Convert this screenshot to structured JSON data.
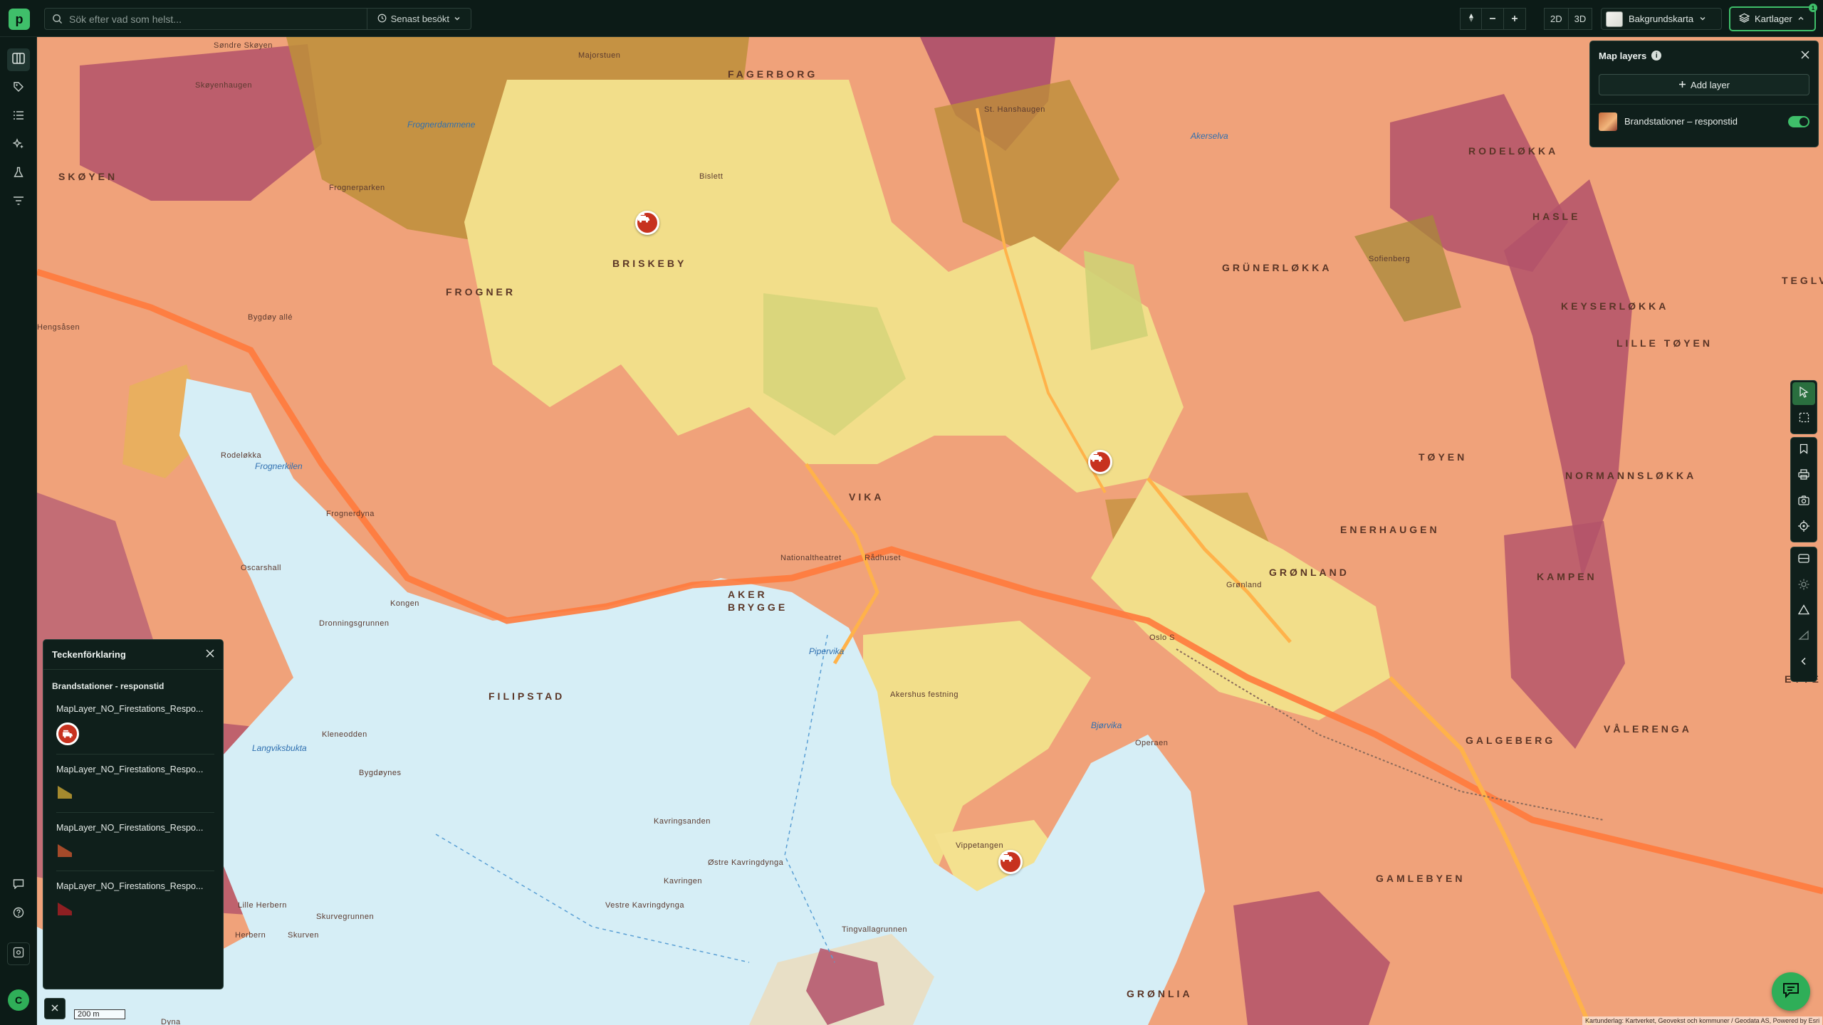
{
  "topbar": {
    "search_placeholder": "Sök efter vad som helst...",
    "recent_label": "Senast besökt",
    "view_2d": "2D",
    "view_3d": "3D",
    "basemap_label": "Bakgrundskarta",
    "layers_label": "Kartlager",
    "layers_badge": "1"
  },
  "user": {
    "initial": "C"
  },
  "layers_panel": {
    "title": "Map layers",
    "add_layer_label": "Add layer",
    "layers": [
      {
        "name": "Brandstationer – responstid",
        "visible": true
      }
    ]
  },
  "legend": {
    "title": "Teckenförklaring",
    "group_title": "Brandstationer - responstid",
    "items": [
      {
        "label": "MapLayer_NO_Firestations_Respo...",
        "symbol": "firetruck-marker",
        "color": "#c7321f"
      },
      {
        "label": "MapLayer_NO_Firestations_Respo...",
        "symbol": "polygon",
        "color": "#a58a2e"
      },
      {
        "label": "MapLayer_NO_Firestations_Respo...",
        "symbol": "polygon",
        "color": "#a54a2a"
      },
      {
        "label": "MapLayer_NO_Firestations_Respo...",
        "symbol": "polygon",
        "color": "#8e1f22"
      }
    ]
  },
  "map": {
    "scale_label": "200 m",
    "attribution": "Kartunderlag: Kartverket, Geovekst och kommuner / Geodata AS, Powered by Esri",
    "districts": [
      "FAGERBORG",
      "BRISKEBY",
      "FROGNER",
      "SKØYEN",
      "RODELØKKA",
      "GRÜNERLØKKA",
      "HASLE",
      "KEYSERLØKKA",
      "LILLE TØYEN",
      "TEGLVE",
      "TØYEN",
      "NORMANNSLØKKA",
      "ENERHAUGEN",
      "GRØNLAND",
      "KAMPEN",
      "VÅLERENGA",
      "GALGEBERG",
      "GAMLEBYEN",
      "AKER BRYGGE",
      "FILIPSTAD",
      "VIKA",
      "GRØNLIA",
      "ETTE"
    ],
    "places": [
      "Søndre Skøyen",
      "Skøyenhaugen",
      "Frognerparken",
      "Frognerdammene",
      "Majorstuen",
      "Bislett",
      "Sofienberg",
      "Akerselva",
      "St. Hanshaugen",
      "Frognerkilen",
      "Frognerdyna",
      "Oscarshall",
      "Rodeløkka",
      "Kongen",
      "Dronningsgrunnen",
      "Hengsåsen",
      "Bygdøy allé",
      "Kleneodden",
      "Bygdøynes",
      "Langviksbukta",
      "Lille Herbern",
      "Herbern",
      "Skurven",
      "Skurvegrunnen",
      "Kavringsanden",
      "Kavringen",
      "Østre Kavringdynga",
      "Vestre Kavringdynga",
      "Tingvallagrunnen",
      "Pipervika",
      "Akershus festning",
      "Bjørvika",
      "Operaen",
      "Nationaltheatret",
      "Oslo S",
      "Rådhuset",
      "Grønland",
      "Vippetangen",
      "Dyna"
    ]
  }
}
